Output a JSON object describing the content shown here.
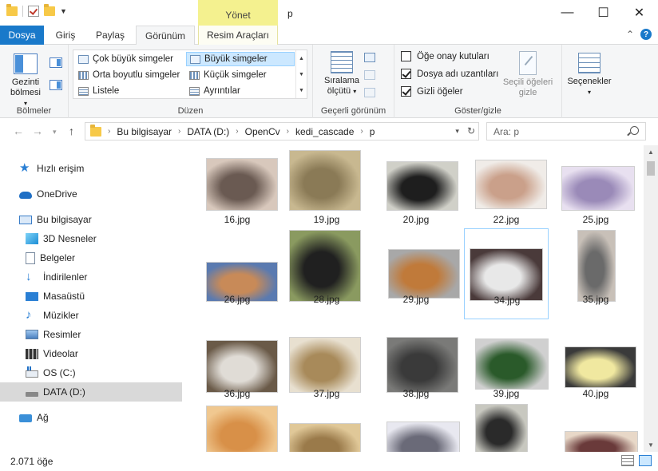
{
  "window": {
    "title": "p",
    "context_group": "Yönet",
    "controls": {
      "minimize": "—",
      "maximize": "☐",
      "close": "✕"
    }
  },
  "tabs": [
    {
      "label": "Dosya"
    },
    {
      "label": "Giriş"
    },
    {
      "label": "Paylaş"
    },
    {
      "label": "Görünüm"
    },
    {
      "label": "Resim Araçları"
    }
  ],
  "ribbon": {
    "panes": {
      "nav_pane_line1": "Gezinti",
      "nav_pane_line2": "bölmesi",
      "group": "Bölmeler"
    },
    "layout": {
      "items": [
        "Çok büyük simgeler",
        "Büyük simgeler",
        "Orta boyutlu simgeler",
        "Küçük simgeler",
        "Listele",
        "Ayrıntılar"
      ],
      "selected": "Büyük simgeler",
      "group": "Düzen"
    },
    "current_view": {
      "sort_line1": "Sıralama",
      "sort_line2": "ölçütü",
      "group": "Geçerli görünüm"
    },
    "show_hide": {
      "checkboxes": [
        {
          "label": "Öğe onay kutuları",
          "checked": false
        },
        {
          "label": "Dosya adı uzantıları",
          "checked": true
        },
        {
          "label": "Gizli öğeler",
          "checked": true
        }
      ],
      "hide_selected_line1": "Seçili öğeleri",
      "hide_selected_line2": "gizle",
      "group": "Göster/gizle"
    },
    "options": {
      "label": "Seçenekler"
    }
  },
  "address": {
    "crumbs": [
      "Bu bilgisayar",
      "DATA (D:)",
      "OpenCv",
      "kedi_cascade",
      "p"
    ],
    "search_placeholder": "Ara: p"
  },
  "nav_pane": {
    "items": [
      {
        "label": "Hızlı erişim",
        "icon": "star-icon"
      },
      {
        "label": "OneDrive",
        "icon": "cloud-icon"
      },
      {
        "label": "Bu bilgisayar",
        "icon": "computer-icon"
      },
      {
        "label": "3D Nesneler",
        "icon": "cube-icon"
      },
      {
        "label": "Belgeler",
        "icon": "document-icon"
      },
      {
        "label": "İndirilenler",
        "icon": "download-icon"
      },
      {
        "label": "Masaüstü",
        "icon": "desktop-icon"
      },
      {
        "label": "Müzikler",
        "icon": "music-icon"
      },
      {
        "label": "Resimler",
        "icon": "pictures-icon"
      },
      {
        "label": "Videolar",
        "icon": "video-icon"
      },
      {
        "label": "OS (C:)",
        "icon": "windows-drive-icon"
      },
      {
        "label": "DATA (D:)",
        "icon": "drive-icon"
      },
      {
        "label": "Ağ",
        "icon": "network-icon"
      }
    ],
    "selected": "DATA (D:)"
  },
  "files": [
    {
      "name": "16.jpg",
      "colors": [
        "#6a5a52",
        "#d8c8bc"
      ]
    },
    {
      "name": "19.jpg",
      "colors": [
        "#8a7a56",
        "#c8b890"
      ]
    },
    {
      "name": "20.jpg",
      "colors": [
        "#1e1e1e",
        "#d0d0c8"
      ]
    },
    {
      "name": "22.jpg",
      "colors": [
        "#caa08a",
        "#f0ece8"
      ]
    },
    {
      "name": "25.jpg",
      "colors": [
        "#9a8ab8",
        "#e8e0f0"
      ]
    },
    {
      "name": "26.jpg",
      "colors": [
        "#c88a58",
        "#5a7ab0"
      ]
    },
    {
      "name": "28.jpg",
      "colors": [
        "#202020",
        "#8a9a60"
      ]
    },
    {
      "name": "29.jpg",
      "colors": [
        "#c07a3a",
        "#a8a8a8"
      ]
    },
    {
      "name": "34.jpg",
      "colors": [
        "#e8e8e8",
        "#4a3a3a"
      ]
    },
    {
      "name": "35.jpg",
      "colors": [
        "#6a6a6a",
        "#c8c0b8"
      ]
    },
    {
      "name": "36.jpg",
      "colors": [
        "#e0dcd6",
        "#6a5a48"
      ]
    },
    {
      "name": "37.jpg",
      "colors": [
        "#a88a5a",
        "#e8e0d0"
      ]
    },
    {
      "name": "38.jpg",
      "colors": [
        "#3a3a3a",
        "#7a7a78"
      ]
    },
    {
      "name": "39.jpg",
      "colors": [
        "#2a5a2a",
        "#d0d0d0"
      ]
    },
    {
      "name": "40.jpg",
      "colors": [
        "#f0e8a0",
        "#3a3a3a"
      ]
    },
    {
      "name": "",
      "colors": [
        "#d89048",
        "#f0c890"
      ]
    },
    {
      "name": "",
      "colors": [
        "#9a7a4a",
        "#e0c898"
      ]
    },
    {
      "name": "",
      "colors": [
        "#6a6a78",
        "#e8e8f0"
      ]
    },
    {
      "name": "",
      "colors": [
        "#2a2a2a",
        "#c8c8c0"
      ]
    },
    {
      "name": "",
      "colors": [
        "#6a3a3a",
        "#e8d8c8"
      ]
    }
  ],
  "selected_file": "34.jpg",
  "status": {
    "count": "2.071 öğe"
  },
  "colors": {
    "file_tab": "#1979ca",
    "context_tab": "#f4f18f",
    "selection": "#cce8ff"
  }
}
